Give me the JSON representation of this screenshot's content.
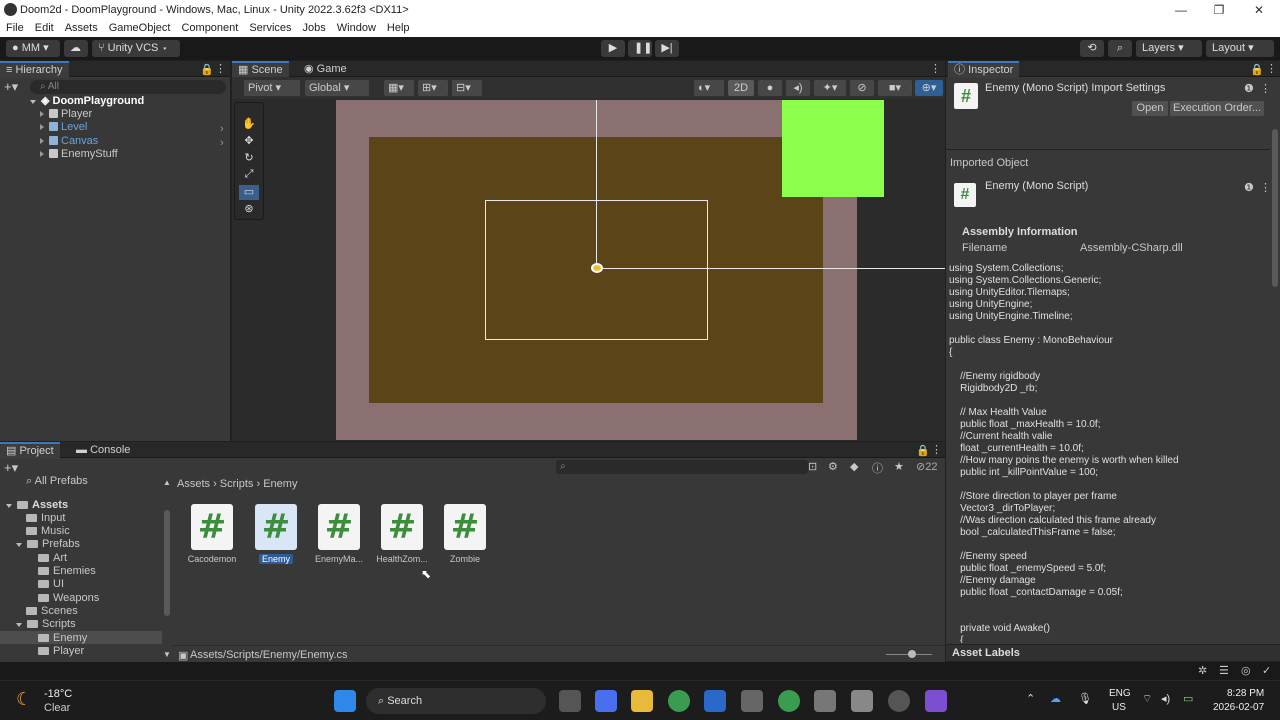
{
  "window": {
    "title": "Doom2d - DoomPlayground - Windows, Mac, Linux - Unity 2022.3.62f3 <DX11>",
    "min": "—",
    "max": "❐",
    "close": "✕"
  },
  "menu": [
    "File",
    "Edit",
    "Assets",
    "GameObject",
    "Component",
    "Services",
    "Jobs",
    "Window",
    "Help"
  ],
  "toolbar": {
    "account": "MM",
    "vcs": "Unity VCS",
    "layers": "Layers",
    "layout": "Layout"
  },
  "hierarchy": {
    "tab": "Hierarchy",
    "search_placeholder": "All",
    "scene": "DoomPlayground",
    "items": [
      "Player",
      "Level",
      "Canvas",
      "EnemyStuff"
    ]
  },
  "scene": {
    "tab_scene": "Scene",
    "tab_game": "Game",
    "pivot": "Pivot",
    "global": "Global",
    "mode2d": "2D"
  },
  "inspector": {
    "tab": "Inspector",
    "title": "Enemy (Mono Script) Import Settings",
    "open_button": "Open",
    "exec_button": "Execution Order...",
    "imported_label": "Imported Object",
    "imported_name": "Enemy (Mono Script)",
    "assembly_header": "Assembly Information",
    "filename_label": "Filename",
    "filename_value": "Assembly-CSharp.dll",
    "asset_labels": "Asset Labels",
    "code": [
      "using System.Collections;",
      "using System.Collections.Generic;",
      "using UnityEditor.Tilemaps;",
      "using UnityEngine;",
      "using UnityEngine.Timeline;",
      "",
      "public class Enemy : MonoBehaviour",
      "{",
      "",
      "    //Enemy rigidbody",
      "    Rigidbody2D _rb;",
      "",
      "    // Max Health Value",
      "    public float _maxHealth = 10.0f;",
      "    //Current health valie",
      "    float _currentHealth = 10.0f;",
      "    //How many poins the enemy is worth when killed",
      "    public int _killPointValue = 100;",
      "",
      "    //Store direction to player per frame",
      "    Vector3 _dirToPlayer;",
      "    //Was direction calculated this frame already",
      "    bool _calculatedThisFrame = false;",
      "",
      "    //Enemy speed",
      "    public float _enemySpeed = 5.0f;",
      "    //Enemy damage",
      "    public float _contactDamage = 0.05f;",
      "",
      "",
      "    private void Awake()",
      "    {"
    ]
  },
  "project": {
    "tab_project": "Project",
    "tab_console": "Console",
    "count": "22",
    "breadcrumb": [
      "Assets",
      "Scripts",
      "Enemy"
    ],
    "tree_top": "All Prefabs",
    "tree": [
      "Assets",
      "Input",
      "Music",
      "Prefabs",
      "Art",
      "Enemies",
      "UI",
      "Weapons",
      "Scenes",
      "Scripts",
      "Enemy",
      "Player"
    ],
    "assets": [
      "Cacodemon",
      "Enemy",
      "EnemyMa...",
      "HealthZom...",
      "Zombie"
    ],
    "path": "Assets/Scripts/Enemy/Enemy.cs"
  },
  "taskbar": {
    "temp": "-18°C",
    "weather": "Clear",
    "search": "Search",
    "lang1": "ENG",
    "lang2": "US",
    "time": "8:28 PM",
    "date": "2026-02-07"
  },
  "colors": {
    "accent": "#3a79bb",
    "green_box": "#8cff4d",
    "level_fill": "#5a4418",
    "level_border": "#8a7070"
  }
}
